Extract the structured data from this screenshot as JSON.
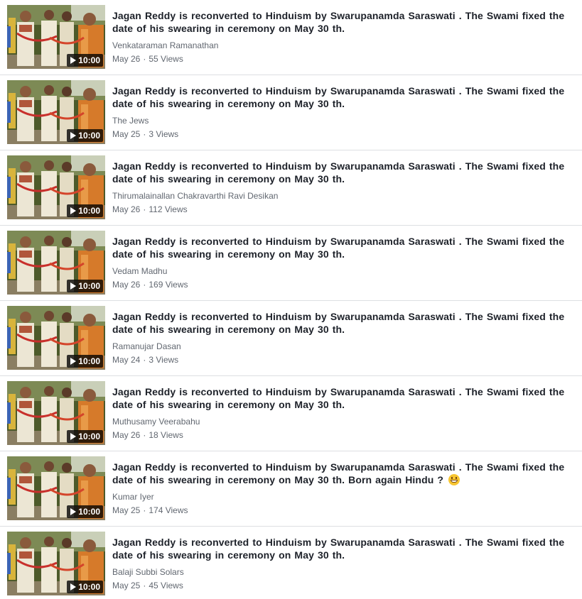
{
  "videos": [
    {
      "duration": "10:00",
      "title": "Jagan Reddy is reconverted to Hinduism by Swarupanamda Saraswati . The Swami fixed the date of his swearing in ceremony on May 30 th.",
      "author": "Venkataraman Ramanathan",
      "date": "May 26",
      "views": "55 Views"
    },
    {
      "duration": "10:00",
      "title": "Jagan Reddy is reconverted to Hinduism by Swarupanamda Saraswati . The Swami fixed the date of his swearing in ceremony on May 30 th.",
      "author": "The Jews",
      "date": "May 25",
      "views": "3 Views"
    },
    {
      "duration": "10:00",
      "title": "Jagan Reddy is reconverted to Hinduism by Swarupanamda Saraswati . The Swami fixed the date of his swearing in ceremony on May 30 th.",
      "author": "Thirumalainallan Chakravarthi Ravi Desikan",
      "date": "May 26",
      "views": "112 Views"
    },
    {
      "duration": "10:00",
      "title": "Jagan Reddy is reconverted to Hinduism by Swarupanamda Saraswati . The Swami fixed the date of his swearing in ceremony on May 30 th.",
      "author": "Vedam Madhu",
      "date": "May 26",
      "views": "169 Views"
    },
    {
      "duration": "10:00",
      "title": "Jagan Reddy is reconverted to Hinduism by Swarupanamda Saraswati . The Swami fixed the date of his swearing in ceremony on May 30 th.",
      "author": "Ramanujar Dasan",
      "date": "May 24",
      "views": "3 Views"
    },
    {
      "duration": "10:00",
      "title": "Jagan Reddy is reconverted to Hinduism by Swarupanamda Saraswati . The Swami fixed the date of his swearing in ceremony on May 30 th.",
      "author": "Muthusamy Veerabahu",
      "date": "May 26",
      "views": "18 Views"
    },
    {
      "duration": "10:00",
      "title": "Jagan Reddy is reconverted to Hinduism by Swarupanamda Saraswati . The Swami fixed the date of his swearing in ceremony on May 30 th. Born again Hindu ?",
      "emoji": "grinning-face-emoji",
      "author": "Kumar Iyer",
      "date": "May 25",
      "views": "174 Views"
    },
    {
      "duration": "10:00",
      "title": "Jagan Reddy is reconverted to Hinduism by Swarupanamda Saraswati . The Swami fixed the date of his swearing in ceremony on May 30 th.",
      "author": "Balaji Subbi Solars",
      "date": "May 25",
      "views": "45 Views"
    }
  ],
  "meta_separator": "·",
  "icons": {
    "play": "play-icon",
    "thumbnail": "video-thumbnail"
  },
  "colors": {
    "title": "#1d2129",
    "meta": "#616770",
    "divider": "#dddfe2",
    "duration_badge_bg": "#000000"
  }
}
